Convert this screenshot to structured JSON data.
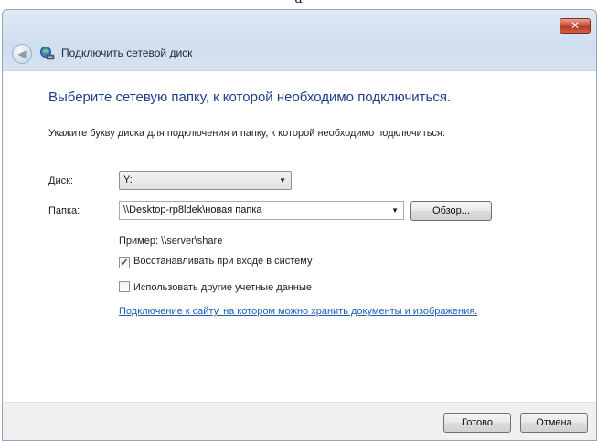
{
  "caption": "a",
  "window": {
    "title": "Подключить сетевой диск",
    "close_glyph": "✕"
  },
  "icons": {
    "back": "◀",
    "dropdown": "▼"
  },
  "content": {
    "heading": "Выберите сетевую папку, к которой необходимо подключиться.",
    "instruction": "Укажите букву диска для подключения и папку, к которой необходимо подключиться:",
    "drive_label": "Диск:",
    "drive_value": "Y:",
    "folder_label": "Папка:",
    "folder_value": "\\\\Desktop-rp8ldek\\новая папка",
    "browse_button": "Обзор...",
    "example": "Пример: \\\\server\\share",
    "reconnect_checkbox": {
      "label": "Восстанавливать при входе в систему",
      "checked": true,
      "mark": "✓"
    },
    "credentials_checkbox": {
      "label": "Использовать другие учетные данные",
      "checked": false
    },
    "link_text": "Подключение к сайту, на котором можно хранить документы и изображения",
    "link_period": "."
  },
  "footer": {
    "finish_button": "Готово",
    "cancel_button": "Отмена"
  }
}
